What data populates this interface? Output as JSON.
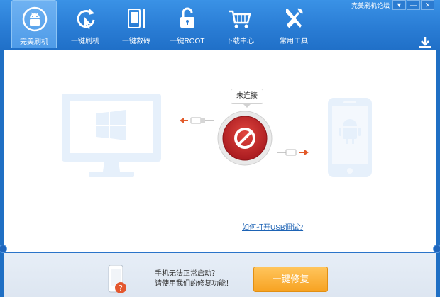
{
  "window": {
    "top_link": "完美刷机论坛",
    "buttons": [
      "▼",
      "—",
      "✕"
    ]
  },
  "nav": {
    "items": [
      {
        "label": "完美刷机",
        "icon": "android-icon",
        "active": true
      },
      {
        "label": "一键刷机",
        "icon": "one-click-flash-icon",
        "active": false
      },
      {
        "label": "一键救砖",
        "icon": "unbrick-tools-icon",
        "active": false
      },
      {
        "label": "一键ROOT",
        "icon": "unlock-icon",
        "active": false
      },
      {
        "label": "下载中心",
        "icon": "shopping-cart-icon",
        "active": false
      },
      {
        "label": "常用工具",
        "icon": "tools-icon",
        "active": false
      }
    ]
  },
  "connection": {
    "status_badge": "未连接",
    "usb_help_link": "如何打开USB调试?"
  },
  "bottom": {
    "line1": "手机无法正常启动？",
    "line2": "请使用我们的修复功能！",
    "repair_button": "一键修复"
  },
  "colors": {
    "header": "#2a7dd5",
    "accent_orange": "#f7a322",
    "disconnect_red": "#c8262a",
    "ghost_blue": "#e6f0fb"
  }
}
